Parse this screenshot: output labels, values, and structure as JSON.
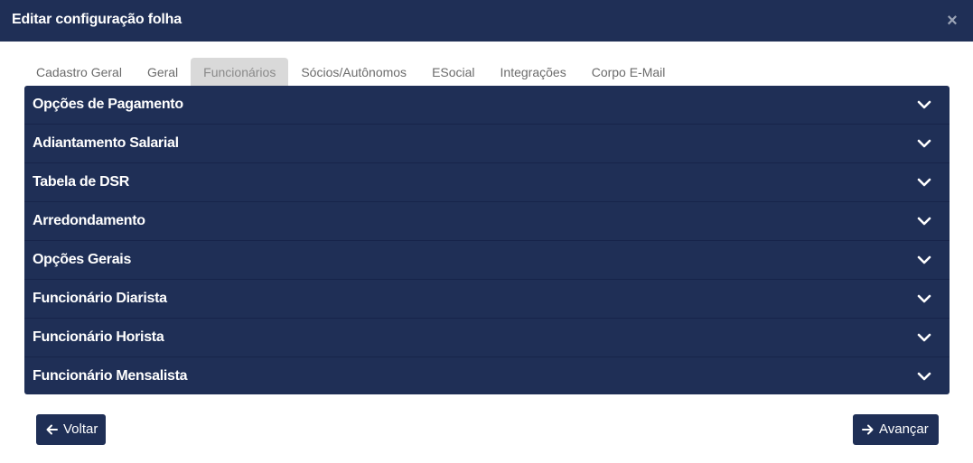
{
  "dialog": {
    "title": "Editar configuração folha",
    "close_glyph": "×"
  },
  "tabs": [
    {
      "label": "Cadastro Geral",
      "active": false
    },
    {
      "label": "Geral",
      "active": false
    },
    {
      "label": "Funcionários",
      "active": true
    },
    {
      "label": "Sócios/Autônomos",
      "active": false
    },
    {
      "label": "ESocial",
      "active": false
    },
    {
      "label": "Integrações",
      "active": false
    },
    {
      "label": "Corpo E-Mail",
      "active": false
    }
  ],
  "accordion": [
    {
      "label": "Opções de Pagamento",
      "icon": "chevron-down-icon"
    },
    {
      "label": "Adiantamento Salarial",
      "icon": "chevron-down-icon"
    },
    {
      "label": "Tabela de DSR",
      "icon": "chevron-down-icon"
    },
    {
      "label": "Arredondamento",
      "icon": "chevron-down-icon"
    },
    {
      "label": "Opções Gerais",
      "icon": "chevron-down-icon"
    },
    {
      "label": "Funcionário Diarista",
      "icon": "chevron-down-icon"
    },
    {
      "label": "Funcionário Horista",
      "icon": "chevron-down-icon"
    },
    {
      "label": "Funcionário Mensalista",
      "icon": "chevron-down-icon"
    }
  ],
  "footer": {
    "back_label": "Voltar",
    "back_icon": "arrow-left-icon",
    "next_label": "Avançar",
    "next_icon": "arrow-right-icon"
  },
  "colors": {
    "header_bg": "#1f2f56",
    "accordion_bg": "#1f2f56",
    "active_tab_bg": "#d9d9d9"
  }
}
